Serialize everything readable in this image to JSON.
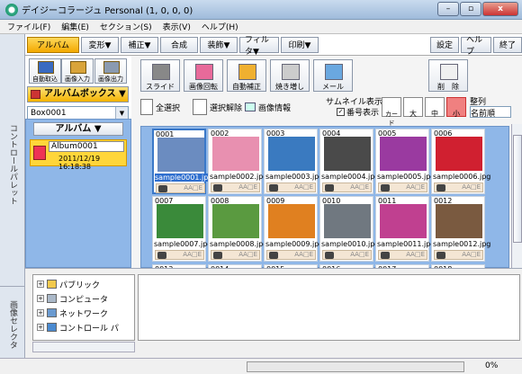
{
  "window": {
    "title": "デイジーコラージュ Personal (1, 0, 0, 0)",
    "min": "–",
    "max": "▫",
    "close": "x"
  },
  "menu": [
    "ファイル(F)",
    "編集(E)",
    "セクション(S)",
    "表示(V)",
    "ヘルプ(H)"
  ],
  "left_rail": {
    "top": "コントロールパレット",
    "bottom": "画像セレクタ"
  },
  "tabs": [
    "アルバム",
    "変形▼",
    "補正▼",
    "合成",
    "装飾▼",
    "フィルタ▼",
    "印刷▼"
  ],
  "right_tabs": [
    "設定",
    "ヘルプ",
    "終了"
  ],
  "small_buttons": [
    "自動取込",
    "画像入力",
    "画像出力"
  ],
  "album_box_label": "アルバムボックス ▼",
  "box_select": "Box0001",
  "big_buttons": [
    "スライド",
    "画像回転",
    "自動補正",
    "焼き増し",
    "メール"
  ],
  "delete_button": "削　除",
  "options": {
    "select_all": "全選択",
    "deselect": "選択解除",
    "image_info": "画像情報",
    "thumbnail_display": "サムネイル表示",
    "number_display": "番号表示",
    "card": "カード",
    "large": "大",
    "medium": "中",
    "small": "小",
    "sort": "整列",
    "sort_value": "名前順"
  },
  "album_panel": {
    "header": "アルバム ▼",
    "name": "Album0001",
    "date": "2011/12/19 16:18:38"
  },
  "thumbnails": [
    {
      "num": "0001",
      "file": "sample0001.jpg",
      "color": "#6b8cc0",
      "selected": true
    },
    {
      "num": "0002",
      "file": "sample0002.jpg",
      "color": "#e890b0"
    },
    {
      "num": "0003",
      "file": "sample0003.jpg",
      "color": "#3a7ac0"
    },
    {
      "num": "0004",
      "file": "sample0004.jpg",
      "color": "#4a4a4a"
    },
    {
      "num": "0005",
      "file": "sample0005.jpg",
      "color": "#9a3aa0"
    },
    {
      "num": "0006",
      "file": "sample0006.jpg",
      "color": "#d02030"
    },
    {
      "num": "0007",
      "file": "sample0007.jpg",
      "color": "#3a8a3a"
    },
    {
      "num": "0008",
      "file": "sample0008.jpg",
      "color": "#5a9a40"
    },
    {
      "num": "0009",
      "file": "sample0009.jpg",
      "color": "#e08020"
    },
    {
      "num": "0010",
      "file": "sample0010.jpg",
      "color": "#707880"
    },
    {
      "num": "0011",
      "file": "sample0011.jpg",
      "color": "#c04090"
    },
    {
      "num": "0012",
      "file": "sample0012.jpg",
      "color": "#7a5a40"
    }
  ],
  "partial_numbers": [
    "0013",
    "0014",
    "0015",
    "0016",
    "0017",
    "0018"
  ],
  "cell_tags": "AA□E",
  "tree": [
    "パブリック",
    "コンピュータ",
    "ネットワーク",
    "コントロール パ"
  ],
  "status": {
    "percent": "0%"
  }
}
